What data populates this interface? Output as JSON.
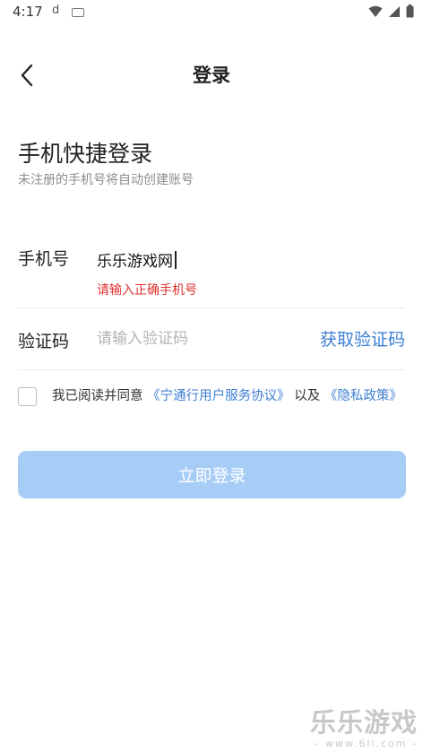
{
  "status_bar": {
    "time": "4:17",
    "notification_glyph": "d",
    "icons": [
      "keyboard-icon",
      "wifi-icon",
      "signal-icon",
      "battery-icon"
    ]
  },
  "header": {
    "title": "登录",
    "back_icon": "back-chevron-icon"
  },
  "intro": {
    "title": "手机快捷登录",
    "subtitle": "未注册的手机号将自动创建账号"
  },
  "phone_field": {
    "label": "手机号",
    "value": "乐乐游戏网",
    "error": "请输入正确手机号"
  },
  "code_field": {
    "label": "验证码",
    "placeholder": "请输入验证码",
    "value": "",
    "get_code_label": "获取验证码"
  },
  "agreement": {
    "checked": false,
    "prefix": "我已阅读并同意",
    "service_link": "《宁通行用户服务协议》",
    "connector": "以及",
    "privacy_link": "《隐私政策》"
  },
  "login_button": {
    "label": "立即登录",
    "enabled": false
  },
  "watermark": {
    "title": "乐乐游戏",
    "url": "- www.6ll.com -"
  },
  "colors": {
    "accent": "#3f7fd3",
    "error": "#e0312f",
    "button_disabled": "#a7cdf7",
    "placeholder": "#b4b4b4"
  }
}
